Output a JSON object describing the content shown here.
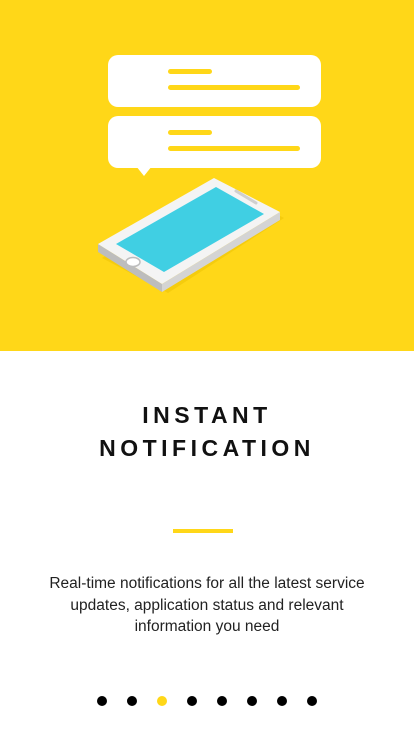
{
  "hero": {
    "background_color": "#FFD718",
    "illustration": [
      "chat-bubble-icon",
      "chat-bubble-icon",
      "smartphone-icon"
    ]
  },
  "onboarding": {
    "title_line1": "INSTANT",
    "title_line2": "NOTIFICATION",
    "description": "Real-time notifications for all the latest service updates, application status and relevant information you need"
  },
  "pager": {
    "total_pages": 8,
    "active_page": 3,
    "active_color": "#FFD718",
    "inactive_color": "#000000"
  }
}
